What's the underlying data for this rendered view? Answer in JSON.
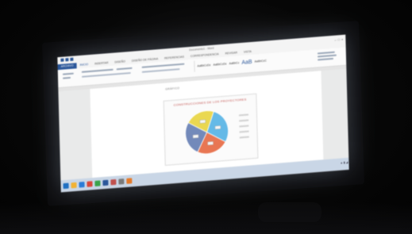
{
  "window": {
    "title": "Documento1 - Word"
  },
  "ribbon": {
    "tabs": [
      "ARCHIVO",
      "INICIO",
      "INSERTAR",
      "DISEÑO",
      "DISEÑO DE PÁGINA",
      "REFERENCIAS",
      "CORRESPONDENCIA",
      "REVISAR",
      "VISTA"
    ],
    "styles": [
      "AaBbCcDc",
      "AaBbCcDc",
      "AaBbCc",
      "AaB",
      "AaBbCcC"
    ]
  },
  "document": {
    "heading": "GRÁFICO",
    "chart_title": "CONSTRUCCIONES DE LOS PROYECTORES"
  },
  "chart_data": {
    "type": "pie",
    "title": "CONSTRUCCIONES DE LOS PROYECTORES",
    "slices": [
      {
        "value": 28,
        "color": "#5fb7e6"
      },
      {
        "value": 24,
        "color": "#e8734f"
      },
      {
        "value": 26,
        "color": "#6f86b8"
      },
      {
        "value": 22,
        "color": "#e9d64a"
      }
    ]
  },
  "colors": {
    "accent": "#2b579a",
    "screen_bg": "#e9eaea"
  }
}
